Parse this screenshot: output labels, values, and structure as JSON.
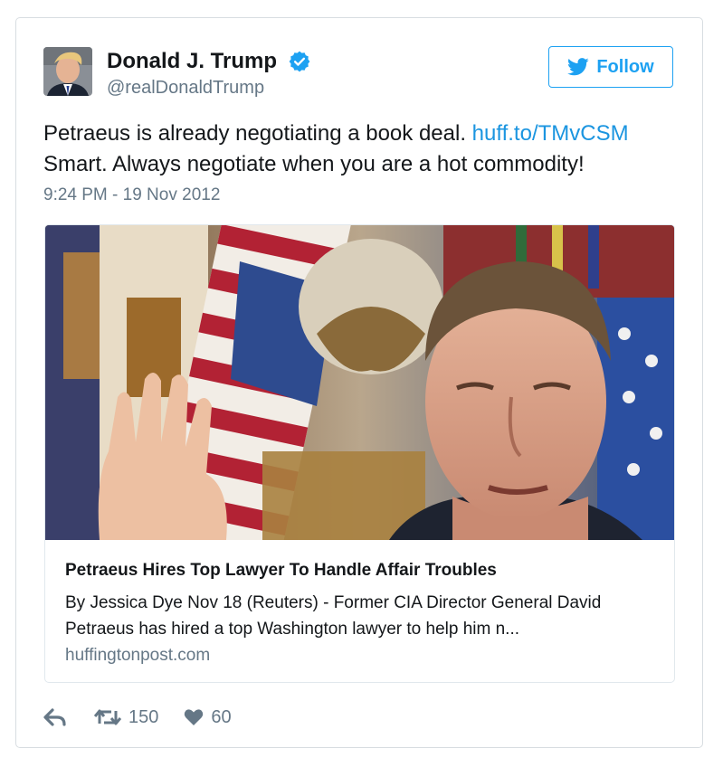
{
  "author": {
    "name": "Donald J. Trump",
    "handle": "@realDonaldTrump",
    "verified": true,
    "avatar_icon": "profile-photo"
  },
  "follow_button": {
    "label": "Follow",
    "icon": "twitter-bird-icon"
  },
  "tweet": {
    "text_part1": "Petraeus is already negotiating a book deal.",
    "link_text": "huff.to/TMvCSM",
    "text_part2": "Smart. Always negotiate when you are a hot commodity!",
    "timestamp": "9:24 PM - 19 Nov 2012"
  },
  "link_card": {
    "image_icon": "article-photo",
    "title": "Petraeus Hires Top Lawyer To Handle Affair Troubles",
    "description": "By Jessica Dye Nov 18 (Reuters) - Former CIA Director General David Petraeus has hired a top Washington lawyer to help him n...",
    "domain": "huffingtonpost.com"
  },
  "actions": {
    "reply_icon": "reply-icon",
    "retweet_icon": "retweet-icon",
    "retweet_count": "150",
    "like_icon": "heart-icon",
    "like_count": "60"
  },
  "colors": {
    "accent": "#1da1f2",
    "link": "#1b95e0",
    "secondary_text": "#657786",
    "border": "#e1e8ed"
  }
}
